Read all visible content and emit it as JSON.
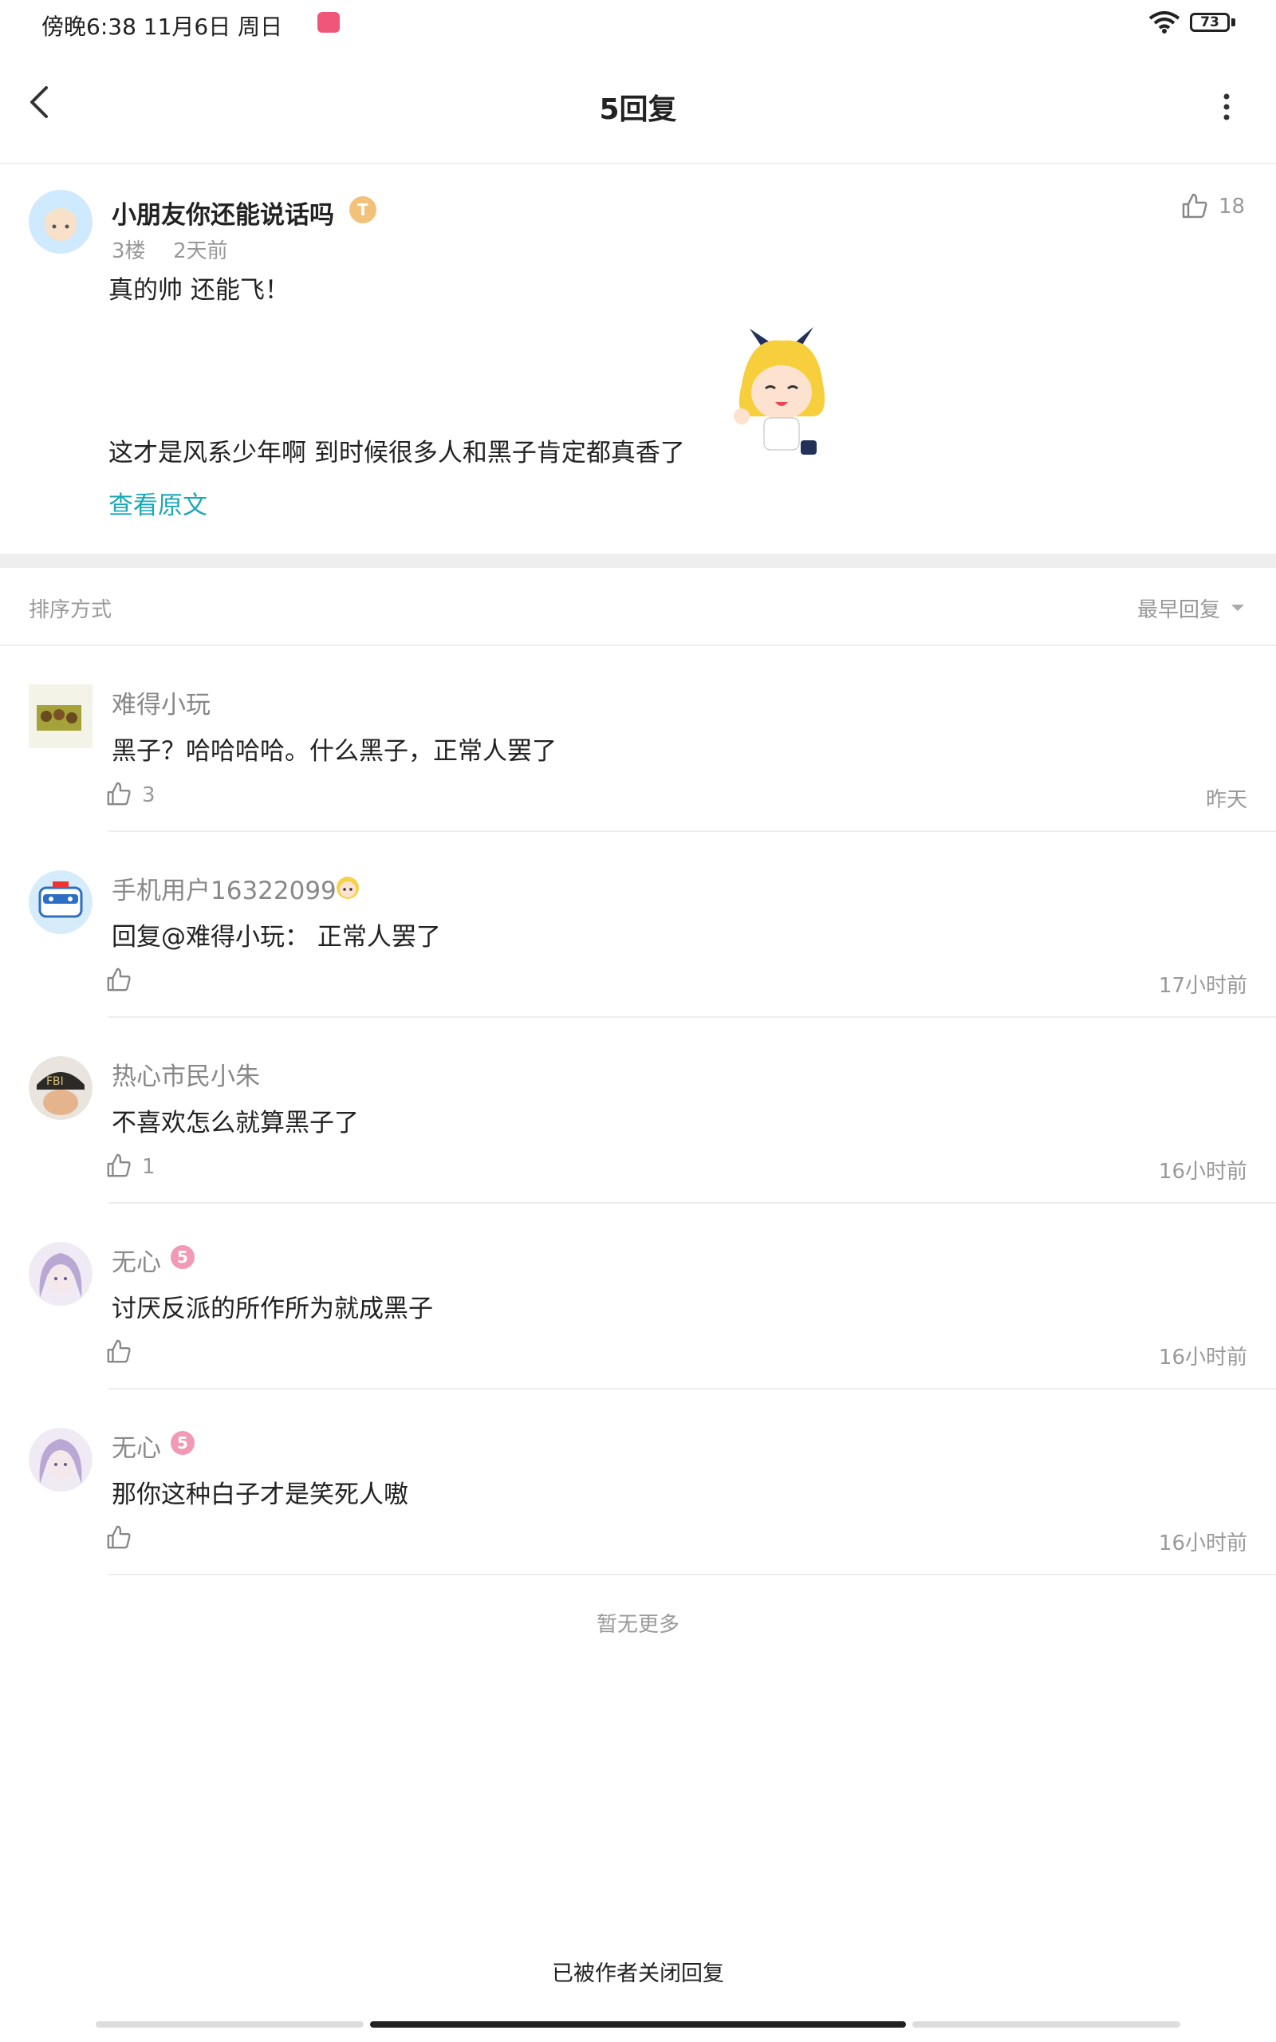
{
  "status_bar": {
    "time": "傍晚6:38  11月6日  周日",
    "battery": "73"
  },
  "nav": {
    "title": "5回复"
  },
  "main_post": {
    "username": "小朋友你还能说话吗",
    "level_badge": "T",
    "likes": "18",
    "floor": "3楼",
    "time": "2天前",
    "text_line1": "真的帅 还能飞！",
    "text_line2": "这才是风系少年啊 到时候很多人和黑子肯定都真香了",
    "view_original": "查看原文"
  },
  "sort": {
    "label": "排序方式",
    "order": "最早回复"
  },
  "replies": [
    {
      "name": "难得小玩",
      "text": "黑子？哈哈哈哈。什么黑子，正常人罢了",
      "reply_to": "",
      "likes": "3",
      "time": "昨天"
    },
    {
      "name": "手机用户16322099",
      "text": "正常人罢了",
      "reply_to": "回复@难得小玩：",
      "likes": "",
      "time": "17小时前"
    },
    {
      "name": "热心市民小朱",
      "text": "不喜欢怎么就算黑子了",
      "reply_to": "",
      "likes": "1",
      "time": "16小时前"
    },
    {
      "name": "无心",
      "text": "讨厌反派的所作所为就成黑子",
      "reply_to": "",
      "likes": "",
      "time": "16小时前"
    },
    {
      "name": "无心",
      "text": "那你这种白子才是笑死人嗷",
      "reply_to": "",
      "likes": "",
      "time": "16小时前"
    }
  ],
  "footer": {
    "no_more": "暂无更多",
    "closed": "已被作者关闭回复"
  },
  "colors": {
    "accent": "#1aa8b8",
    "muted": "#999999",
    "divider": "#eeeeee"
  }
}
